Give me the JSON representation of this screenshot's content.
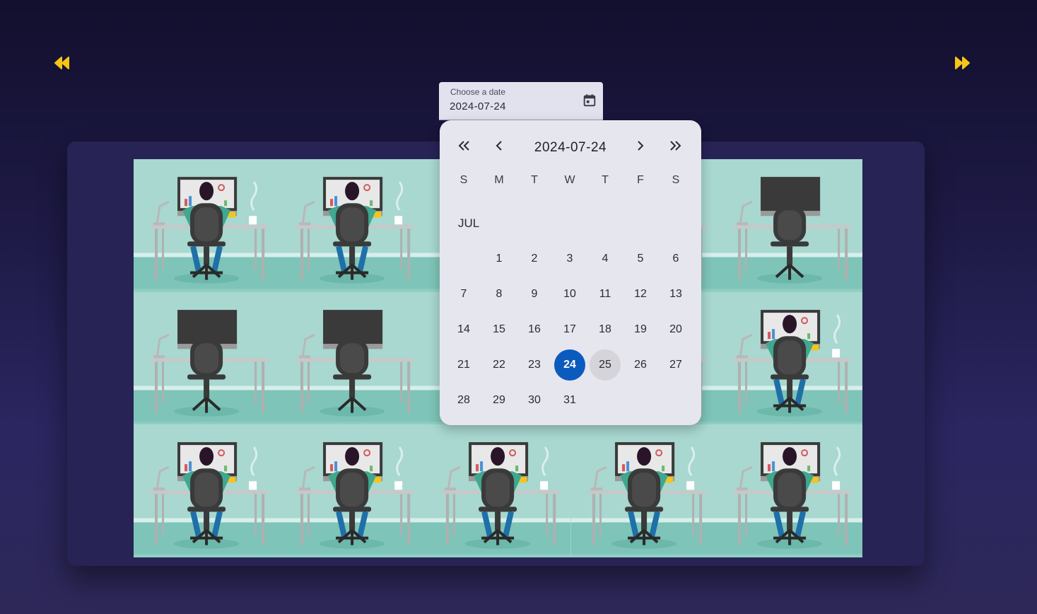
{
  "navigation": {
    "prev_icon": "fast-rewind-icon",
    "next_icon": "fast-forward-icon",
    "accent": "#f5c518"
  },
  "date_field": {
    "label": "Choose a date",
    "value": "2024-07-24",
    "toggle_icon": "calendar-icon"
  },
  "calendar": {
    "title": "2024-07-24",
    "prev_year_icon": "double-chevron-left-icon",
    "prev_month_icon": "chevron-left-icon",
    "next_month_icon": "chevron-right-icon",
    "next_year_icon": "double-chevron-right-icon",
    "weekdays": [
      "S",
      "M",
      "T",
      "W",
      "T",
      "F",
      "S"
    ],
    "month_label": "JUL",
    "first_weekday_offset": 1,
    "days": [
      "1",
      "2",
      "3",
      "4",
      "5",
      "6",
      "7",
      "8",
      "9",
      "10",
      "11",
      "12",
      "13",
      "14",
      "15",
      "16",
      "17",
      "18",
      "19",
      "20",
      "21",
      "22",
      "23",
      "24",
      "25",
      "26",
      "27",
      "28",
      "29",
      "30",
      "31"
    ],
    "selected_day": "24",
    "hovered_day": "25",
    "selected_color": "#0b5bbf"
  },
  "grid": {
    "occupancy": [
      [
        true,
        true,
        true,
        true,
        false
      ],
      [
        false,
        false,
        false,
        false,
        true
      ],
      [
        true,
        true,
        true,
        true,
        true
      ]
    ],
    "empty_state": "dark-monitor-illustration",
    "occupied_state": "person-at-desk-illustration"
  }
}
